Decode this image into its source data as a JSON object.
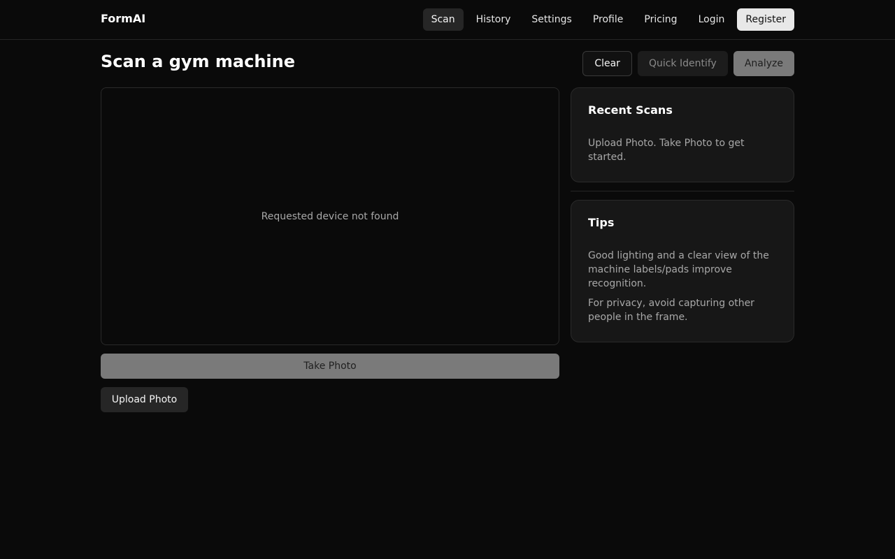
{
  "app": {
    "brand": "FormAI"
  },
  "nav": {
    "items": [
      {
        "label": "Scan",
        "active": true
      },
      {
        "label": "History"
      },
      {
        "label": "Settings"
      },
      {
        "label": "Profile"
      },
      {
        "label": "Pricing"
      },
      {
        "label": "Login"
      },
      {
        "label": "Register"
      }
    ]
  },
  "header": {
    "title": "Scan a gym machine",
    "clear_label": "Clear",
    "quick_identify_label": "Quick Identify",
    "analyze_label": "Analyze"
  },
  "camera": {
    "message": "Requested device not found",
    "take_photo_label": "Take Photo",
    "upload_photo_label": "Upload Photo"
  },
  "recent_scans": {
    "title": "Recent Scans",
    "empty_text": "Upload Photo. Take Photo to get started."
  },
  "tips": {
    "title": "Tips",
    "items": [
      "Good lighting and a clear view of the machine labels/pads improve recognition.",
      "For privacy, avoid capturing other people in the frame."
    ]
  },
  "colors": {
    "background": "#0a0a0a",
    "card": "#171717",
    "active_nav": "#262626",
    "register_bg": "#e8e8e8",
    "disabled_button": "#7a7a7a"
  }
}
